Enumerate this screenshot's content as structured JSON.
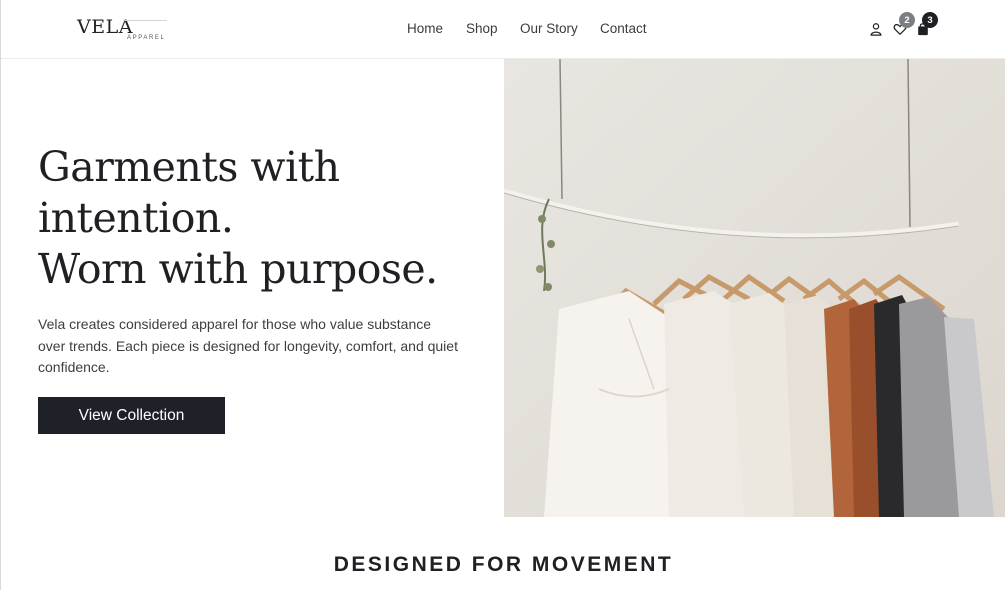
{
  "brand": {
    "name": "VELA",
    "tagline": "APPAREL"
  },
  "nav": {
    "items": [
      "Home",
      "Shop",
      "Our Story",
      "Contact"
    ]
  },
  "header_icons": {
    "account": {
      "icon": "user-icon"
    },
    "wishlist": {
      "icon": "heart-icon",
      "count": "2"
    },
    "cart": {
      "icon": "bag-icon",
      "count": "3"
    }
  },
  "hero": {
    "title_lines": [
      "Garments with",
      "intention.",
      "Worn with purpose."
    ],
    "description": "Vela creates considered apparel for those who value substance over trends. Each piece is designed for longevity, comfort, and quiet confidence.",
    "cta_label": "View Collection",
    "image_alt": "clothing-rack-photo"
  },
  "section": {
    "title": "DESIGNED FOR MOVEMENT"
  },
  "colors": {
    "primary": "#1e2228",
    "text": "#1e2024",
    "badge_gray": "#7b7f85",
    "muted_text": "#3c3e42"
  }
}
